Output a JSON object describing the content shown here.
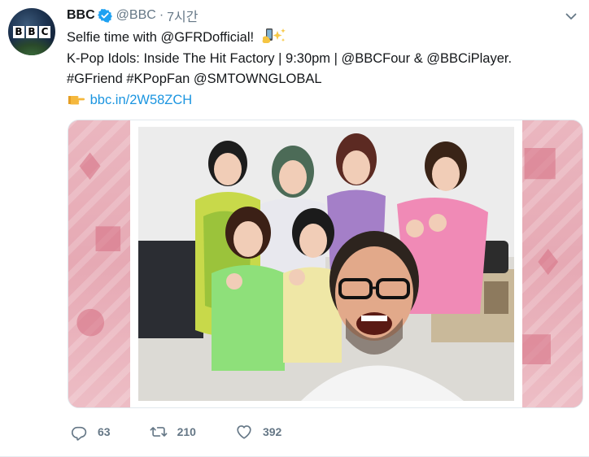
{
  "tweet": {
    "author_name": "BBC",
    "author_handle": "@BBC",
    "separator": "·",
    "timestamp": "7시간",
    "avatar_logo": [
      "B",
      "B",
      "C"
    ],
    "text_lines": {
      "line1": "Selfie time with @GFRDofficial!",
      "line2": "K-Pop Idols: Inside The Hit Factory | 9:30pm | @BBCFour & @BBCiPlayer.",
      "line3": "#GFriend #KPopFan @SMTOWNGLOBAL",
      "line4_link": "bbc.in/2W58ZCH"
    },
    "media_alt": "selfie photo"
  },
  "actions": {
    "replies": "63",
    "retweets": "210",
    "likes": "392"
  },
  "colors": {
    "link": "#1b95e0",
    "secondary": "#657786",
    "verified": "#1da1f2",
    "media_side": "#e8b7bf"
  },
  "icons": {
    "verified": "verified-badge-icon",
    "caret": "chevron-down-icon",
    "reply": "reply-icon",
    "retweet": "retweet-icon",
    "like": "heart-icon",
    "emoji_phone": "selfie-phone-emoji-icon",
    "emoji_sparkles": "sparkles-emoji-icon",
    "emoji_point": "pointing-right-emoji-icon"
  }
}
